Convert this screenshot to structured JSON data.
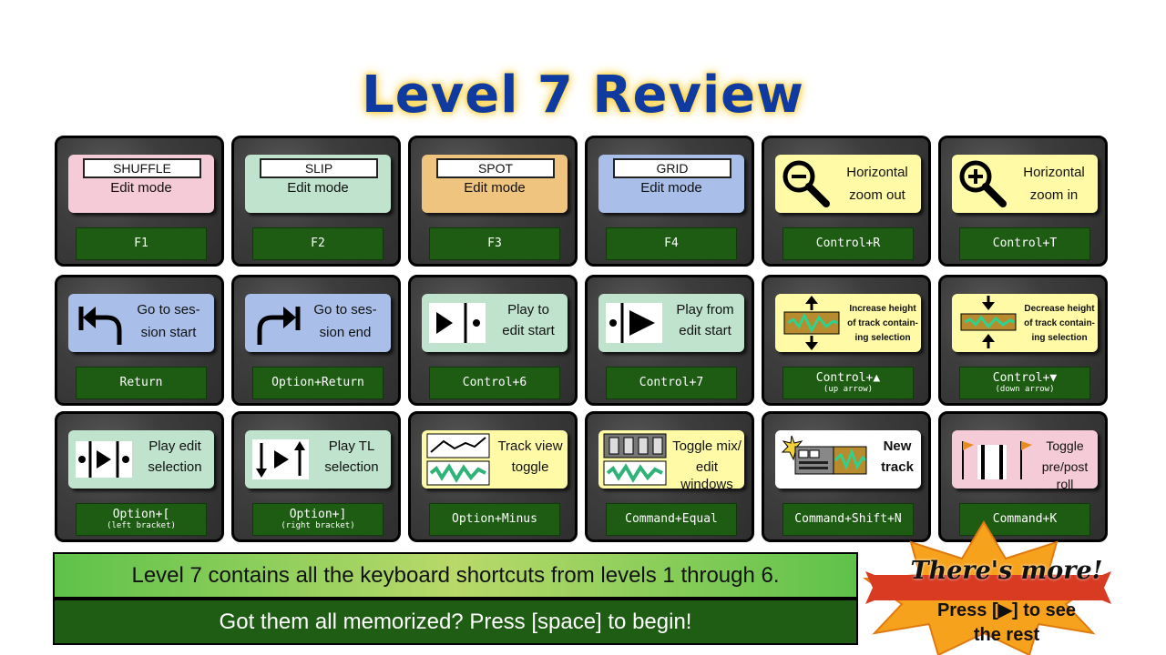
{
  "title": "Level 7 Review",
  "cards": [
    {
      "mode": "SHUFFLE",
      "label": "Edit mode",
      "key": "F1"
    },
    {
      "mode": "SLIP",
      "label": "Edit mode",
      "key": "F2"
    },
    {
      "mode": "SPOT",
      "label": "Edit mode",
      "key": "F3"
    },
    {
      "mode": "GRID",
      "label": "Edit mode",
      "key": "F4"
    },
    {
      "line1": "Horizontal",
      "line2": "zoom out",
      "key": "Control+R"
    },
    {
      "line1": "Horizontal",
      "line2": "zoom in",
      "key": "Control+T"
    },
    {
      "line1": "Go to ses-",
      "line2": "sion start",
      "key": "Return"
    },
    {
      "line1": "Go to ses-",
      "line2": "sion end",
      "key": "Option+Return"
    },
    {
      "line1": "Play to",
      "line2": "edit start",
      "key": "Control+6"
    },
    {
      "line1": "Play from",
      "line2": "edit start",
      "key": "Control+7"
    },
    {
      "line1": "Increase height",
      "line2": "of track contain-",
      "line3": "ing selection",
      "key": "Control+▲",
      "sub": "(up arrow)"
    },
    {
      "line1": "Decrease height",
      "line2": "of track contain-",
      "line3": "ing selection",
      "key": "Control+▼",
      "sub": "(down arrow)"
    },
    {
      "line1": "Play edit",
      "line2": "selection",
      "key": "Option+[",
      "sub": "(left bracket)"
    },
    {
      "line1": "Play TL",
      "line2": "selection",
      "key": "Option+]",
      "sub": "(right bracket)"
    },
    {
      "line1": "Track view",
      "line2": "toggle",
      "key": "Option+Minus"
    },
    {
      "line1": "Toggle mix/",
      "line2": "edit windows",
      "key": "Command+Equal"
    },
    {
      "line1": "New",
      "line2": "track",
      "key": "Command+Shift+N"
    },
    {
      "line1": "Toggle",
      "line2": "pre/post roll",
      "key": "Command+K"
    }
  ],
  "banner": {
    "line1": "Level 7 contains all the keyboard shortcuts from levels 1 through 6.",
    "line2": "Got them all memorized? Press [space] to begin!"
  },
  "star": {
    "headline": "There's more!",
    "line1": "Press [▶] to see",
    "line2": "the rest"
  },
  "colors": {
    "title": "#0f3aa0",
    "key_bg": "#1e5c14",
    "banner_top": "#5ec24a",
    "banner_bottom": "#1f5c14",
    "star": "#f7a21c"
  }
}
